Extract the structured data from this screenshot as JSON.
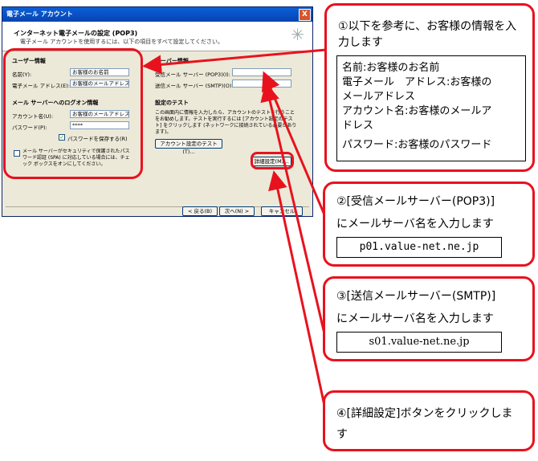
{
  "dialog": {
    "title": "電子メール アカウント",
    "close": "X",
    "header_title": "インターネット電子メールの設定 (POP3)",
    "header_sub": "電子メール アカウントを使用するには、以下の項目をすべて設定してください。",
    "user_section": "ユーザー情報",
    "name_label": "名前(Y):",
    "name_value": "お客様のお名前",
    "email_label": "電子メール アドレス(E):",
    "email_value": "お客様のメールアドレス",
    "logon_section": "メール サーバーへのログオン情報",
    "account_label": "アカウント名(U):",
    "account_value": "お客様のメールアドレス",
    "password_label": "パスワード(P):",
    "password_value": "****",
    "remember_pw": "パスワードを保存する(R)",
    "remember_checked": "✓",
    "spa_text": "メール サーバーがセキュリティで保護されたパスワード認証 (SPA) に対応している場合には、チェック ボックスをオンにしてください。",
    "server_section": "サーバー情報",
    "pop3_label": "受信メール サーバー (POP3)(I):",
    "smtp_label": "送信メール サーバー (SMTP)(O):",
    "test_section": "設定のテスト",
    "test_text": "この画面内に情報を入力したら、アカウントのテストを行うことをお勧めします。テストを実行するには [アカウント設定のテスト] をクリックします (ネットワークに接続されている必要があります)。",
    "test_button": "アカウント設定のテスト(T)...",
    "detail_button": "詳細設定(M)...",
    "back_button": "< 戻る(B)",
    "next_button": "次へ(N) >",
    "cancel_button": "キャンセル"
  },
  "callouts": {
    "c1_title": "①以下を参考に、お客様の情報を入力します",
    "c1_lines": [
      "名前:お客様のお名前",
      "電子メール　アドレス:お客様の",
      "メールアドレス",
      "アカウント名:お客様のメールア",
      "ドレス",
      "パスワード:お客様のパスワード"
    ],
    "c2_title": "②[受信メールサーバー(POP3)]",
    "c2_sub": "にメールサーバ名を入力します",
    "c2_value": "p01.value-net.ne.jp",
    "c3_title": "③[送信メールサーバー(SMTP)]",
    "c3_sub": "にメールサーバ名を入力します",
    "c3_value": "s01.value-net.ne.jp",
    "c4_title": "④[詳細設定]ボタンをクリックしま",
    "c4_title2": "す"
  },
  "colors": {
    "highlight": "#e8121e",
    "titlebar": "#0a5fd8",
    "dialog_bg": "#ece9d8"
  }
}
